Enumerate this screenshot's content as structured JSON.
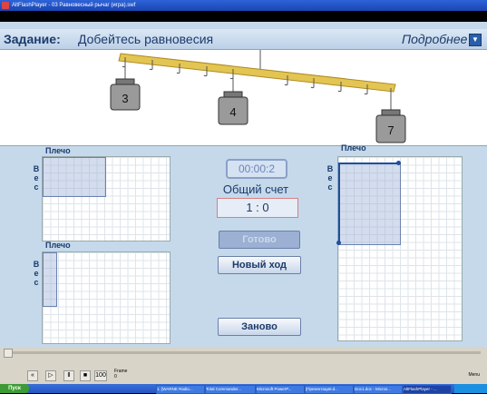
{
  "window": {
    "title": "AltFlashPlayer - 03 Равновесный рычаг (игра).swf"
  },
  "header": {
    "task_label": "Задание:",
    "task_text": "Добейтесь равновесия",
    "more_label": "Подробнее"
  },
  "weights": [
    {
      "label": "3"
    },
    {
      "label": "4"
    },
    {
      "label": "7"
    }
  ],
  "left_top": {
    "arm_label": "Плечо",
    "weight_letters": [
      "В",
      "е",
      "с"
    ]
  },
  "left_bottom": {
    "arm_label": "Плечо",
    "weight_letters": [
      "В",
      "е",
      "с"
    ]
  },
  "right": {
    "arm_label": "Плечо",
    "weight_letters": [
      "В",
      "е",
      "с"
    ]
  },
  "center": {
    "timer": "00:00:2",
    "score_title": "Общий счет",
    "score": "1 : 0",
    "done_label": "Готово",
    "new_move_label": "Новый ход",
    "again_label": "Заново"
  },
  "player": {
    "frame_label": "Frame",
    "frame_value": "0",
    "zoom": "100",
    "menu_label": "Menu"
  },
  "taskbar": {
    "start": "Пуск",
    "items": [
      "1. [WARNE Radio...",
      "Total Commander...",
      "Microsoft PowerP...",
      "[Презентация.d...",
      "Doc1.doc - Micros...",
      "AltFlashPlayer - ..."
    ]
  },
  "colors": {
    "stage": "#c5d9eb",
    "accent": "#1b3a6b",
    "beam": "#e2c552"
  }
}
